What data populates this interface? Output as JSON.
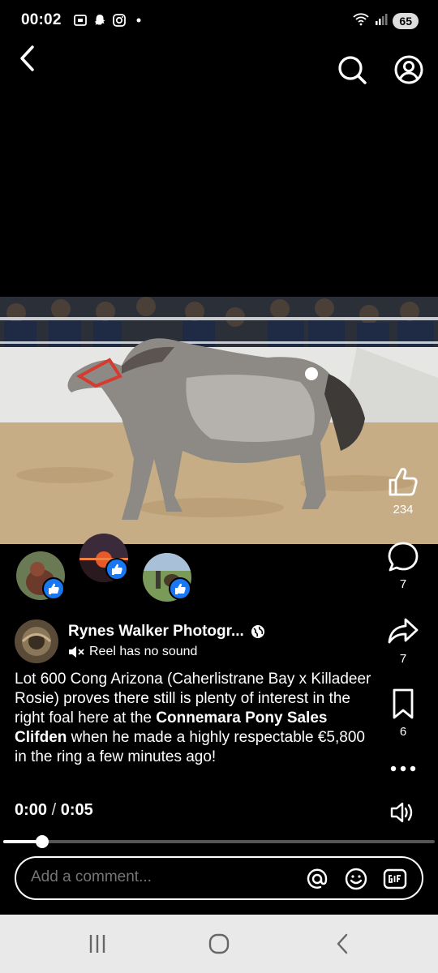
{
  "status_bar": {
    "time": "00:02",
    "battery": "65",
    "icons": [
      "screenshot-icon",
      "snapchat-icon",
      "instagram-icon",
      "dot-icon",
      "wifi-icon",
      "signal-icon"
    ]
  },
  "post": {
    "author": "Rynes Walker Photogr...",
    "sound_note": "Reel has no sound",
    "caption_parts": [
      {
        "text": "Lot 600 Cong Arizona (Caherlistrane Bay x Killadeer Rosie) proves there still is plenty of interest in the right foal here at the ",
        "bold": false
      },
      {
        "text": "Connemara Pony Sales Clifden",
        "bold": true
      },
      {
        "text": " when he made a highly respectable €5,800 in the ring a few minutes ago!",
        "bold": false
      }
    ]
  },
  "rail": {
    "likes": "234",
    "comments": "7",
    "shares": "7",
    "saves": "6"
  },
  "player": {
    "current_time": "0:00",
    "separator": "/",
    "duration": "0:05",
    "progress_fraction": 0.09
  },
  "comment": {
    "placeholder": "Add a comment..."
  },
  "colors": {
    "background": "#000000",
    "like_badge": "#1877f2",
    "nav_bar": "#e9e9ea"
  }
}
